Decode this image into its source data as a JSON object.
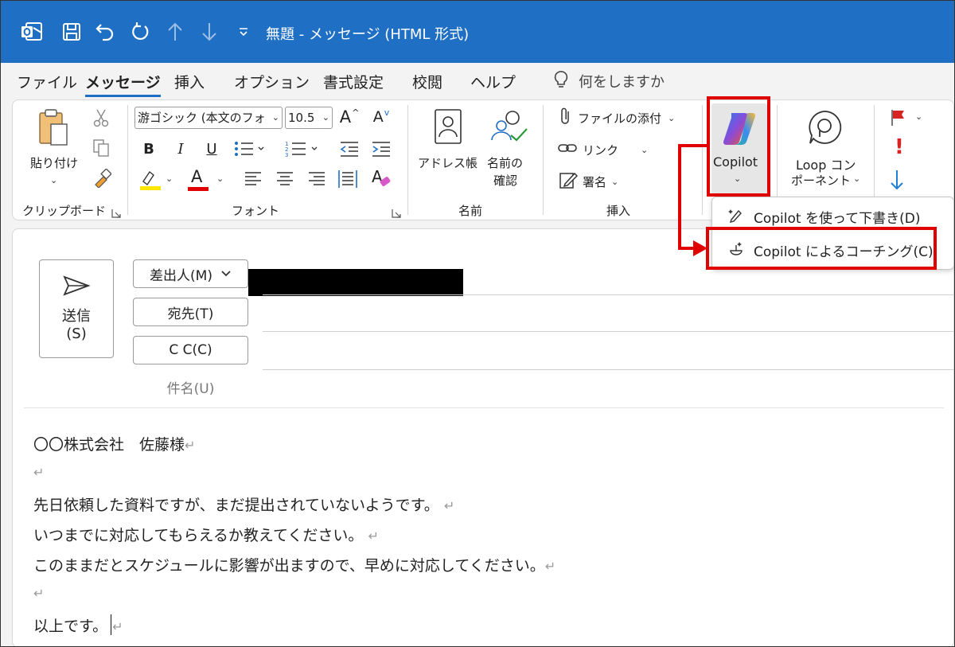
{
  "titlebar": {
    "title": "無題  -  メッセージ (HTML 形式)",
    "icons": [
      "outlook-icon",
      "save-icon",
      "undo-icon",
      "redo-icon",
      "up-arrow-icon",
      "down-arrow-icon",
      "customize-icon"
    ]
  },
  "menu": {
    "tabs": [
      "ファイル",
      "メッセージ",
      "挿入",
      "オプション",
      "書式設定",
      "校閲",
      "ヘルプ"
    ],
    "active_tab": "メッセージ",
    "tell_me": "何をしますか"
  },
  "ribbon": {
    "clipboard": {
      "paste": "貼り付け",
      "group": "クリップボード"
    },
    "font": {
      "font_name": "游ゴシック (本文のフォ",
      "font_size": "10.5",
      "group": "フォント",
      "bold": "B",
      "italic": "I",
      "underline": "U",
      "grow": "A",
      "shrink": "A",
      "color_a": "A",
      "styles_a": "A"
    },
    "names": {
      "address_book": "アドレス帳",
      "check_names_1": "名前の",
      "check_names_2": "確認",
      "group": "名前"
    },
    "insert": {
      "attach": "ファイルの添付",
      "link": "リンク",
      "signature": "署名",
      "group": "挿入"
    },
    "copilot": {
      "label": "Copilot"
    },
    "loop": {
      "label_1": "Loop コン",
      "label_2": "ポーネント"
    },
    "tags": {
      "importance": "!"
    }
  },
  "copilot_menu": {
    "items": [
      {
        "label": "Copilot を使って下書き(D)",
        "icon": "draft-pen-icon"
      },
      {
        "label": "Copilot によるコーチング(C)",
        "icon": "coaching-icon"
      }
    ]
  },
  "compose": {
    "send": {
      "line1": "送信",
      "line2": "(S)"
    },
    "from_label": "差出人(M)",
    "to_label": "宛先(T)",
    "cc_label": "C C(C)",
    "subject_label": "件名(U)",
    "body": [
      "〇〇株式会社　佐藤様",
      "",
      "先日依頼した資料ですが、まだ提出されていないようです。",
      "いつまでに対応してもらえるか教えてください。",
      "このままだとスケジュールに影響が出ますので、早めに対応してください。",
      "",
      "以上です。"
    ],
    "paragraph_mark": "↵"
  },
  "colors": {
    "titlebar": "#1f6fc5",
    "accent": "#1f6fc5",
    "highlight": "#e00000",
    "highlighter": "#ffe600",
    "font_color": "#e00000",
    "flag": "#d82323",
    "down_arrow": "#1f7fd6"
  }
}
